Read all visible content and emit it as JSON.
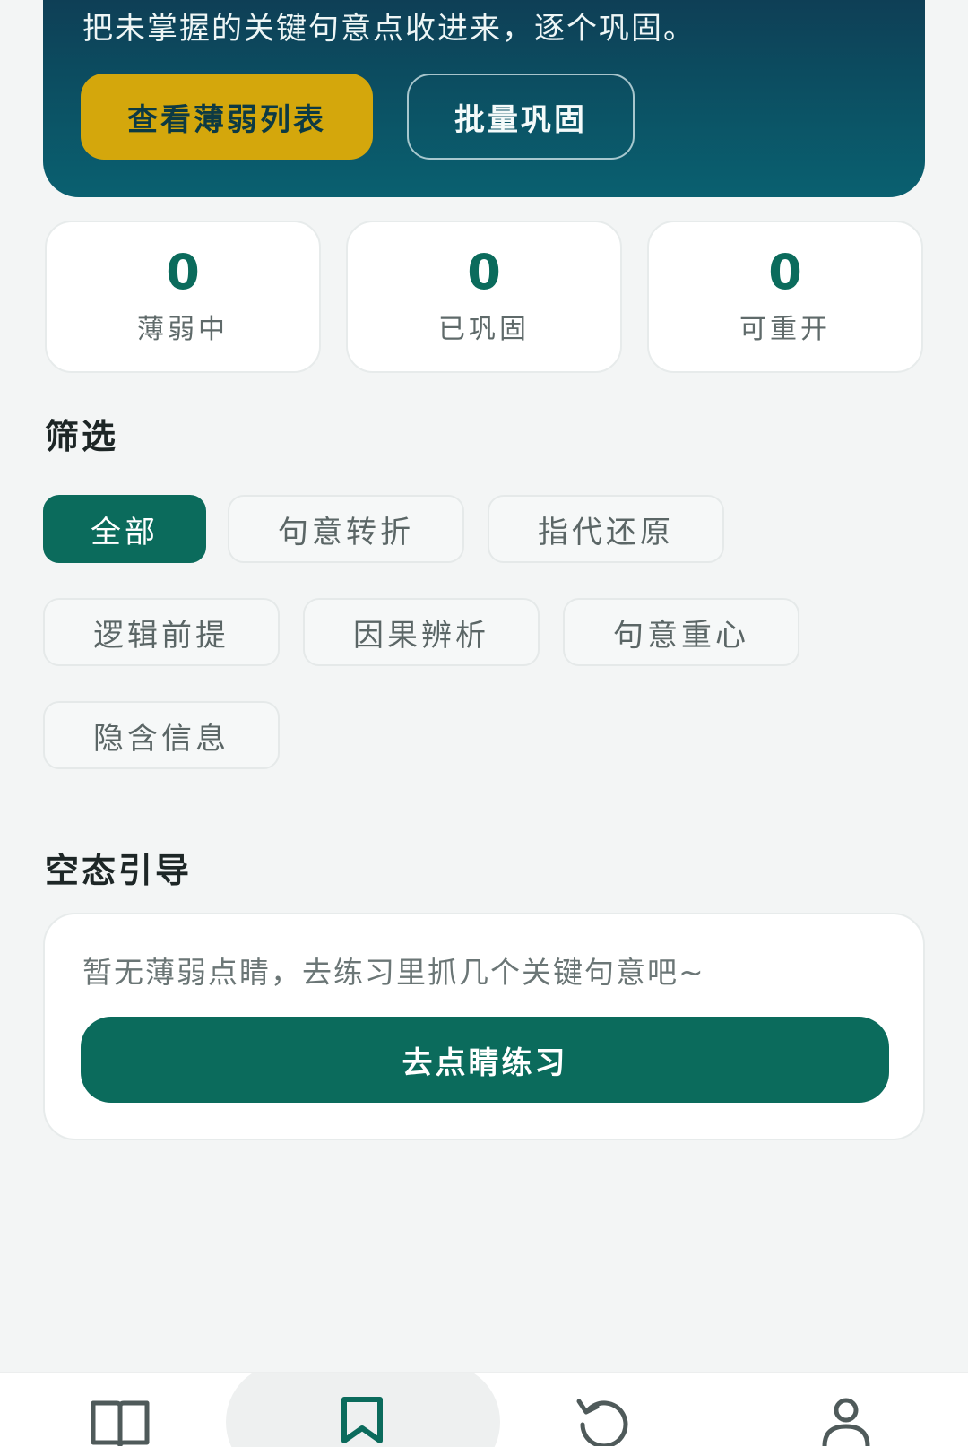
{
  "hero": {
    "text": "把未掌握的关键句意点收进来，逐个巩固。",
    "view_weak_list_label": "查看薄弱列表",
    "batch_consolidate_label": "批量巩固"
  },
  "stats": [
    {
      "value": "0",
      "label": "薄弱中"
    },
    {
      "value": "0",
      "label": "已巩固"
    },
    {
      "value": "0",
      "label": "可重开"
    }
  ],
  "filter": {
    "title": "筛选",
    "chips": [
      {
        "label": "全部",
        "active": true
      },
      {
        "label": "句意转折",
        "active": false
      },
      {
        "label": "指代还原",
        "active": false
      },
      {
        "label": "逻辑前提",
        "active": false
      },
      {
        "label": "因果辨析",
        "active": false
      },
      {
        "label": "句意重心",
        "active": false
      },
      {
        "label": "隐含信息",
        "active": false
      }
    ]
  },
  "empty_state": {
    "title": "空态引导",
    "message": "暂无薄弱点睛，去练习里抓几个关键句意吧~",
    "button_label": "去点睛练习"
  },
  "bottom_nav": {
    "items": [
      {
        "icon": "book-icon",
        "active": false
      },
      {
        "icon": "bookmark-icon",
        "active": true
      },
      {
        "icon": "refresh-icon",
        "active": false
      },
      {
        "icon": "user-icon",
        "active": false
      }
    ]
  },
  "colors": {
    "primary": "#0b6b5c",
    "hero_bg": "#0b5466",
    "accent_yellow": "#d4a70c",
    "page_bg": "#f3f5f5"
  }
}
